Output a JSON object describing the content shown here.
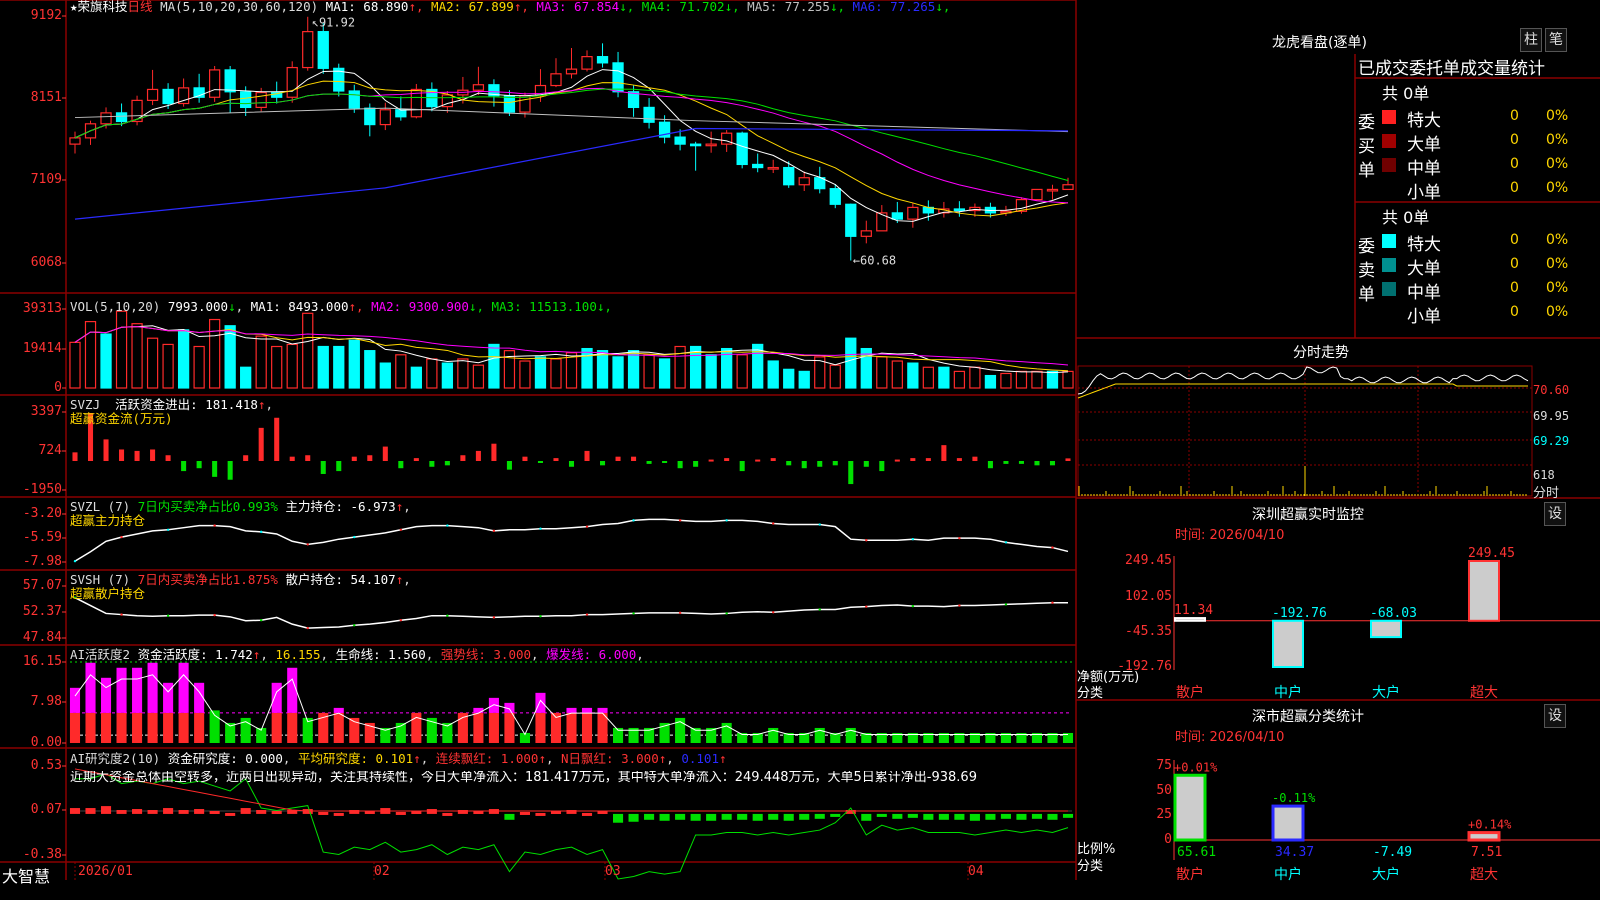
{
  "stock": {
    "star": "★",
    "name": "荣旗科技",
    "period": "日线"
  },
  "brand": "大智慧",
  "colors": {
    "up": "#ff2a2a",
    "down": "#00ffff",
    "green": "#00e000",
    "grid": "#8b0000",
    "magenta": "#ff00ff",
    "yellow": "#ffd700"
  },
  "price_panel": {
    "ma_header": "MA(5,10,20,30,60,120)",
    "ma": [
      {
        "t": "MA1: 68.890",
        "a": "↑",
        "c": "#ffffff"
      },
      {
        "t": "MA2: 67.899",
        "a": "↑",
        "c": "#ffd700"
      },
      {
        "t": "MA3: 67.854",
        "a": "↓",
        "c": "#ff00ff"
      },
      {
        "t": "MA4: 71.702",
        "a": "↓",
        "c": "#00e000"
      },
      {
        "t": "MA5: 77.255",
        "a": "↓",
        "c": "#c0c0c0"
      },
      {
        "t": "MA6: 77.265",
        "a": "↓",
        "c": "#2a2aff"
      }
    ],
    "axis": [
      "9192",
      "8151",
      "7109",
      "6068"
    ],
    "high_label": "91.92",
    "low_label": "60.68"
  },
  "vol_panel": {
    "header": "VOL(5,10,20)",
    "value": "7993.000",
    "ma": [
      {
        "t": "MA1: 8493.000",
        "a": "↑",
        "c": "#ffffff"
      },
      {
        "t": "MA2: 9300.900",
        "a": "↓",
        "c": "#ff00ff"
      },
      {
        "t": "MA3: 11513.100",
        "a": "↓",
        "c": "#00e000"
      }
    ],
    "axis": [
      "39313",
      "19414",
      "0"
    ]
  },
  "svzj_panel": {
    "header": "SVZJ",
    "label": "活跃资金进出: 181.418",
    "sub": "超赢资金流(万元)",
    "axis": [
      "3397",
      "724",
      "-1950"
    ]
  },
  "svzl_panel": {
    "header": "SVZL (7)",
    "ratio": "7日内买卖净占比0.993%",
    "hold": "主力持仓: -6.973",
    "sub": "超赢主力持仓",
    "axis": [
      "-3.20",
      "-5.59",
      "-7.98"
    ]
  },
  "svsh_panel": {
    "header": "SVSH (7)",
    "ratio": "7日内买卖净占比1.875%",
    "hold": "散户持仓: 54.107",
    "sub": "超赢散户持仓",
    "axis": [
      "57.07",
      "52.37",
      "47.84"
    ]
  },
  "ai_active": {
    "header": "AI活跃度2",
    "a": "资金活跃度: 1.742",
    "b": "16.155",
    "c": "生命线: 1.560",
    "d": "强势线: 3.000",
    "e": "爆发线: 6.000",
    "axis": [
      "16.15",
      "7.98",
      "0.00"
    ]
  },
  "ai_research": {
    "header": "AI研究度2(10)",
    "a": "资金研究度: 0.000",
    "b": "平均研究度: 0.101",
    "c": "连续飘红: 1.000",
    "d": "N日飘红: 3.000",
    "e": "0.101",
    "axis": [
      "0.53",
      "0.07",
      "-0.38"
    ],
    "comment": "近期大资金总体由空转多，近两日出现异动，关注其持续性，今日大单净流入：181.417万元，其中特大单净流入：249.448万元，大单5日累计净出-938.69"
  },
  "x_dates": [
    "2026/01",
    "02",
    "03",
    "04"
  ],
  "dragon": {
    "title": "龙虎看盘(逐单)",
    "btn_bar": "柱",
    "btn_pen": "笔",
    "header": "已成交委托单成交量统计",
    "buy": {
      "side": "委买单",
      "total": "共 0单",
      "rows": [
        {
          "l": "特大",
          "v": "0",
          "p": "0%",
          "c": "#ff2020"
        },
        {
          "l": "大单",
          "v": "0",
          "p": "0%",
          "c": "#a00000"
        },
        {
          "l": "中单",
          "v": "0",
          "p": "0%",
          "c": "#700000"
        },
        {
          "l": "小单",
          "v": "0",
          "p": "0%",
          "c": ""
        }
      ]
    },
    "sell": {
      "side": "委卖单",
      "total": "共 0单",
      "rows": [
        {
          "l": "特大",
          "v": "0",
          "p": "0%",
          "c": "#00ffff"
        },
        {
          "l": "大单",
          "v": "0",
          "p": "0%",
          "c": "#009090"
        },
        {
          "l": "中单",
          "v": "0",
          "p": "0%",
          "c": "#007070"
        },
        {
          "l": "小单",
          "v": "0",
          "p": "0%",
          "c": ""
        }
      ]
    }
  },
  "intraday": {
    "title": "分时走势",
    "axis": [
      "70.60",
      "69.95",
      "69.29",
      "618"
    ],
    "unit": "分时"
  },
  "sz_monitor": {
    "title": "深圳超赢实时监控",
    "btn": "设",
    "time": "时间: 2026/04/10",
    "axis": [
      "249.45",
      "102.05",
      "-45.35",
      "-192.76"
    ],
    "ylabel": "净额(万元)",
    "xlabel": "分类",
    "chart_data": {
      "type": "bar",
      "categories": [
        "散户",
        "中户",
        "大户",
        "超大"
      ],
      "values": [
        11.34,
        -192.76,
        -68.03,
        249.45
      ],
      "labels": [
        "11.34",
        "-192.76",
        "-68.03",
        "249.45"
      ],
      "ylim": [
        -192.76,
        249.45
      ]
    }
  },
  "sz_class": {
    "title": "深市超赢分类统计",
    "btn": "设",
    "time": "时间: 2026/04/10",
    "axis": [
      "75",
      "50",
      "25",
      "0"
    ],
    "ylabel": "比例%",
    "xlabel": "分类",
    "chart_data": {
      "type": "bar",
      "categories": [
        "散户",
        "中户",
        "大户",
        "超大"
      ],
      "values": [
        65.61,
        34.37,
        -7.49,
        7.51
      ],
      "top_labels": [
        "+0.01%",
        "-0.11%",
        "",
        "+0.14%"
      ],
      "bottom_labels": [
        "65.61",
        "34.37",
        "-7.49",
        "7.51"
      ],
      "ylim": [
        0,
        75
      ]
    }
  },
  "chart_data": {
    "type": "bar",
    "title": "荣旗科技 日线",
    "dates": [
      "2026/01",
      "02",
      "03",
      "04"
    ],
    "candles": [
      [
        75.6,
        76.4,
        74.4,
        77.2
      ],
      [
        76.4,
        78.2,
        75.5,
        78.6
      ],
      [
        78.2,
        79.6,
        77.6,
        80.3
      ],
      [
        79.6,
        78.5,
        77.9,
        80.8
      ],
      [
        78.5,
        81.2,
        78.0,
        81.8
      ],
      [
        81.2,
        82.6,
        80.6,
        85.1
      ],
      [
        82.6,
        80.8,
        80.1,
        83.4
      ],
      [
        80.8,
        82.8,
        80.4,
        84.0
      ],
      [
        82.8,
        81.6,
        80.9,
        84.6
      ],
      [
        81.6,
        85.1,
        81.0,
        85.6
      ],
      [
        85.1,
        82.3,
        79.6,
        85.6
      ],
      [
        82.3,
        80.3,
        79.2,
        83.0
      ],
      [
        80.3,
        82.2,
        79.8,
        82.8
      ],
      [
        82.2,
        81.6,
        80.8,
        83.6
      ],
      [
        81.6,
        85.4,
        80.9,
        86.2
      ],
      [
        85.4,
        90.0,
        85.0,
        91.9
      ],
      [
        90.0,
        85.3,
        84.6,
        91.1
      ],
      [
        85.3,
        82.4,
        81.7,
        85.9
      ],
      [
        82.4,
        80.2,
        79.6,
        83.2
      ],
      [
        80.2,
        78.1,
        76.6,
        80.8
      ],
      [
        78.1,
        80.0,
        77.4,
        80.9
      ],
      [
        80.0,
        79.1,
        78.6,
        81.7
      ],
      [
        79.1,
        82.6,
        78.9,
        83.3
      ],
      [
        82.6,
        80.4,
        79.8,
        83.5
      ],
      [
        80.4,
        81.9,
        79.6,
        82.4
      ],
      [
        81.9,
        82.5,
        80.8,
        84.2
      ],
      [
        82.5,
        83.2,
        81.9,
        85.5
      ],
      [
        83.2,
        81.8,
        80.4,
        83.9
      ],
      [
        81.8,
        79.7,
        79.2,
        82.5
      ],
      [
        79.7,
        81.8,
        79.0,
        82.2
      ],
      [
        81.8,
        83.1,
        81.0,
        85.2
      ],
      [
        83.1,
        84.6,
        82.9,
        86.6
      ],
      [
        84.6,
        85.2,
        84.0,
        87.9
      ],
      [
        85.2,
        86.8,
        84.9,
        87.6
      ],
      [
        86.8,
        86.0,
        85.4,
        88.5
      ],
      [
        86.0,
        82.3,
        81.6,
        87.4
      ],
      [
        82.3,
        80.3,
        79.1,
        83.1
      ],
      [
        80.3,
        78.4,
        77.6,
        81.5
      ],
      [
        78.4,
        76.5,
        75.7,
        79.3
      ],
      [
        76.5,
        75.6,
        74.8,
        77.5
      ],
      [
        75.6,
        75.4,
        72.2,
        75.9
      ],
      [
        75.4,
        75.6,
        74.5,
        77.2
      ],
      [
        75.6,
        77.0,
        74.6,
        77.4
      ],
      [
        77.0,
        73.0,
        72.5,
        77.2
      ],
      [
        73.0,
        72.6,
        72.0,
        74.4
      ],
      [
        72.6,
        72.6,
        71.9,
        73.6
      ],
      [
        72.6,
        70.4,
        70.0,
        73.4
      ],
      [
        70.4,
        71.3,
        69.6,
        72.1
      ],
      [
        71.3,
        69.9,
        69.3,
        72.7
      ],
      [
        69.9,
        67.9,
        67.4,
        70.5
      ],
      [
        67.9,
        63.8,
        60.7,
        68.0
      ],
      [
        63.8,
        64.5,
        62.9,
        65.8
      ],
      [
        64.5,
        66.8,
        64.5,
        67.8
      ],
      [
        66.8,
        66.0,
        65.5,
        68.2
      ],
      [
        66.0,
        67.5,
        64.9,
        68.1
      ],
      [
        67.5,
        66.8,
        65.8,
        68.4
      ],
      [
        66.8,
        67.3,
        66.2,
        68.2
      ],
      [
        67.3,
        67.1,
        66.3,
        68.3
      ],
      [
        67.1,
        67.5,
        66.3,
        68.0
      ],
      [
        67.5,
        66.8,
        66.2,
        68.1
      ],
      [
        66.8,
        67.0,
        66.4,
        67.7
      ],
      [
        67.0,
        68.5,
        66.7,
        68.8
      ],
      [
        68.5,
        69.8,
        68.4,
        69.8
      ],
      [
        69.8,
        69.8,
        68.5,
        70.4
      ],
      [
        69.8,
        70.4,
        70.0,
        71.3
      ]
    ],
    "volume": [
      [
        22000,
        1
      ],
      [
        32000,
        1
      ],
      [
        26000,
        0
      ],
      [
        37000,
        1
      ],
      [
        31000,
        1
      ],
      [
        24000,
        1
      ],
      [
        21000,
        1
      ],
      [
        28000,
        0
      ],
      [
        20000,
        1
      ],
      [
        33000,
        1
      ],
      [
        30000,
        0
      ],
      [
        10000,
        0
      ],
      [
        25000,
        1
      ],
      [
        20000,
        1
      ],
      [
        21000,
        1
      ],
      [
        36000,
        1
      ],
      [
        20000,
        0
      ],
      [
        20000,
        0
      ],
      [
        23000,
        0
      ],
      [
        18000,
        0
      ],
      [
        12000,
        0
      ],
      [
        16000,
        1
      ],
      [
        10000,
        0
      ],
      [
        14000,
        1
      ],
      [
        12000,
        0
      ],
      [
        14000,
        1
      ],
      [
        11000,
        1
      ],
      [
        21000,
        0
      ],
      [
        18000,
        1
      ],
      [
        13000,
        1
      ],
      [
        15000,
        0
      ],
      [
        14000,
        1
      ],
      [
        17000,
        1
      ],
      [
        19000,
        0
      ],
      [
        18000,
        0
      ],
      [
        15000,
        0
      ],
      [
        18000,
        0
      ],
      [
        16000,
        1
      ],
      [
        14000,
        0
      ],
      [
        20000,
        1
      ],
      [
        20000,
        0
      ],
      [
        16000,
        0
      ],
      [
        19000,
        0
      ],
      [
        16000,
        1
      ],
      [
        21000,
        0
      ],
      [
        13000,
        0
      ],
      [
        9000,
        0
      ],
      [
        8000,
        0
      ],
      [
        15000,
        1
      ],
      [
        11000,
        1
      ],
      [
        24000,
        0
      ],
      [
        19000,
        0
      ],
      [
        15000,
        1
      ],
      [
        13000,
        1
      ],
      [
        12000,
        0
      ],
      [
        10000,
        1
      ],
      [
        10000,
        0
      ],
      [
        8000,
        1
      ],
      [
        10000,
        1
      ],
      [
        6000,
        0
      ],
      [
        7000,
        1
      ],
      [
        8000,
        1
      ],
      [
        8000,
        1
      ],
      [
        8000,
        0
      ],
      [
        8000,
        1
      ]
    ],
    "svzj": [
      600,
      3300,
      1500,
      800,
      700,
      800,
      400,
      -700,
      -500,
      -1100,
      -1300,
      400,
      2300,
      3000,
      300,
      400,
      -900,
      -700,
      300,
      400,
      1000,
      -500,
      200,
      -400,
      -300,
      400,
      700,
      1200,
      -600,
      300,
      -100,
      200,
      -400,
      700,
      -300,
      300,
      300,
      -200,
      -100,
      -500,
      -400,
      100,
      200,
      -700,
      100,
      200,
      -300,
      -500,
      -400,
      -300,
      -1600,
      -400,
      -700,
      100,
      200,
      200,
      1100,
      200,
      300,
      -500,
      -200,
      -200,
      -300,
      -300,
      181
    ],
    "svzl": [
      -7.9,
      -7.0,
      -6.0,
      -5.6,
      -5.3,
      -5.0,
      -4.9,
      -4.7,
      -4.5,
      -4.5,
      -4.6,
      -5.0,
      -5.1,
      -5.3,
      -6.0,
      -6.3,
      -6.1,
      -5.8,
      -5.6,
      -5.4,
      -5.2,
      -4.9,
      -4.6,
      -4.5,
      -4.5,
      -4.6,
      -4.7,
      -5.0,
      -4.9,
      -4.9,
      -4.8,
      -4.8,
      -4.7,
      -4.6,
      -4.4,
      -4.3,
      -4.0,
      -3.9,
      -3.9,
      -4.0,
      -4.1,
      -4.1,
      -4.0,
      -4.0,
      -4.1,
      -4.3,
      -4.4,
      -4.4,
      -4.4,
      -4.6,
      -5.8,
      -5.9,
      -5.9,
      -5.9,
      -5.8,
      -5.9,
      -5.7,
      -5.7,
      -5.7,
      -5.8,
      -6.1,
      -6.3,
      -6.5,
      -6.6,
      -6.97
    ],
    "svsh": [
      55.0,
      53.6,
      52.2,
      52.0,
      51.8,
      51.7,
      51.8,
      51.8,
      51.9,
      51.9,
      51.6,
      50.9,
      51.0,
      51.5,
      50.3,
      49.6,
      49.7,
      49.8,
      50.1,
      50.3,
      50.6,
      51.0,
      51.3,
      51.8,
      51.8,
      51.7,
      51.6,
      51.5,
      51.6,
      51.7,
      51.7,
      51.8,
      51.8,
      52.0,
      52.0,
      52.1,
      52.2,
      52.3,
      52.3,
      52.3,
      52.2,
      52.1,
      52.2,
      52.4,
      52.5,
      52.4,
      52.6,
      52.8,
      52.9,
      52.9,
      53.3,
      53.4,
      53.6,
      53.7,
      53.5,
      53.5,
      53.4,
      53.6,
      53.6,
      53.7,
      53.8,
      53.9,
      54.0,
      54.1,
      54.1
    ],
    "active": [
      [
        11,
        1
      ],
      [
        16,
        2
      ],
      [
        13,
        1
      ],
      [
        15,
        1
      ],
      [
        15,
        1
      ],
      [
        16,
        1
      ],
      [
        12,
        1
      ],
      [
        16,
        1
      ],
      [
        12,
        1
      ],
      [
        6.5,
        0
      ],
      [
        4,
        0
      ],
      [
        5,
        0
      ],
      [
        3,
        0
      ],
      [
        12,
        1
      ],
      [
        15,
        1
      ],
      [
        5,
        0
      ],
      [
        6,
        1
      ],
      [
        7,
        1
      ],
      [
        5,
        1
      ],
      [
        4,
        1
      ],
      [
        3,
        0
      ],
      [
        4,
        0
      ],
      [
        6,
        1
      ],
      [
        5,
        0
      ],
      [
        4,
        0
      ],
      [
        6,
        1
      ],
      [
        7,
        1
      ],
      [
        9,
        1
      ],
      [
        8,
        1
      ],
      [
        2,
        0
      ],
      [
        10,
        1
      ],
      [
        6,
        1
      ],
      [
        7,
        1
      ],
      [
        7,
        1
      ],
      [
        7,
        1
      ],
      [
        3,
        0
      ],
      [
        3,
        0
      ],
      [
        3,
        0
      ],
      [
        4,
        0
      ],
      [
        5,
        0
      ],
      [
        3,
        0
      ],
      [
        3,
        0
      ],
      [
        4,
        0
      ],
      [
        2,
        0
      ],
      [
        2,
        0
      ],
      [
        3,
        0
      ],
      [
        2,
        0
      ],
      [
        2,
        0
      ],
      [
        3,
        0
      ],
      [
        2,
        0
      ],
      [
        3,
        0
      ],
      [
        2,
        0
      ],
      [
        2,
        0
      ],
      [
        2,
        0
      ],
      [
        2,
        0
      ],
      [
        2,
        0
      ],
      [
        2,
        0
      ],
      [
        2,
        0
      ],
      [
        2,
        0
      ],
      [
        2,
        0
      ],
      [
        2,
        0
      ],
      [
        2,
        0
      ],
      [
        2,
        0
      ],
      [
        2,
        0
      ],
      [
        2,
        0
      ]
    ],
    "research": [
      0.1,
      0.1,
      0.12,
      0.08,
      0.09,
      0.08,
      0.1,
      0.08,
      0.09,
      0.07,
      0.05,
      0.1,
      0.08,
      0.07,
      0.08,
      0.09,
      0.06,
      0.05,
      0.08,
      0.07,
      0.1,
      0.06,
      0.07,
      0.09,
      0.05,
      0.08,
      0.07,
      0.09,
      -0.02,
      0.06,
      0.05,
      0.07,
      0.08,
      0.05,
      0.07,
      -0.05,
      -0.04,
      -0.02,
      -0.03,
      -0.02,
      -0.03,
      -0.03,
      -0.02,
      -0.02,
      -0.03,
      -0.02,
      -0.03,
      -0.02,
      -0.01,
      0.02,
      0.08,
      -0.03,
      0.01,
      -0.01,
      0.0,
      -0.02,
      -0.02,
      -0.02,
      -0.03,
      -0.02,
      -0.01,
      -0.02,
      -0.01,
      -0.02,
      0.0
    ]
  }
}
